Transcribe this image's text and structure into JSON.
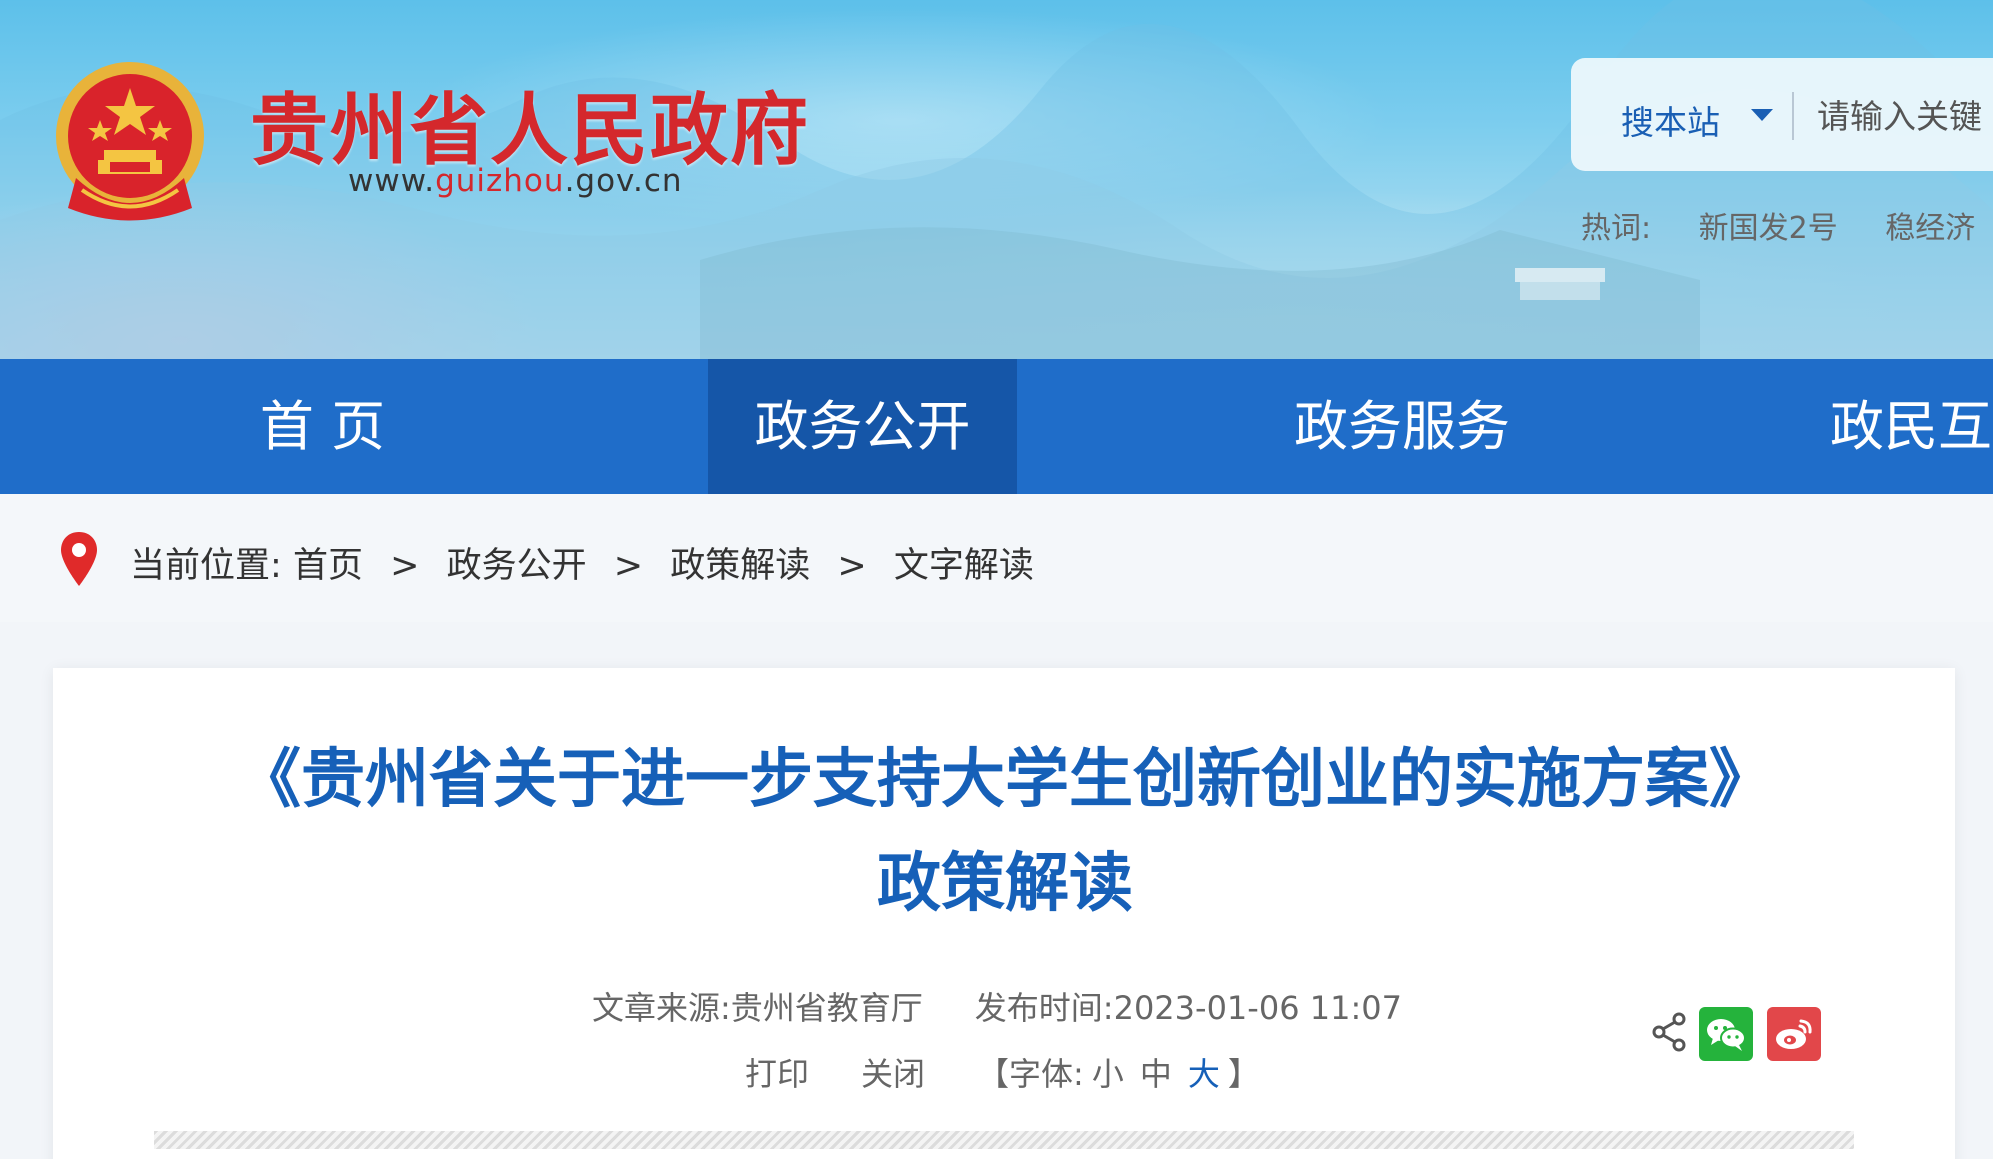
{
  "header": {
    "site_title": "贵州省人民政府",
    "url_prefix": "www.",
    "url_highlight": "guizhou",
    "url_suffix": ".gov.cn",
    "search": {
      "scope_label": "搜本站",
      "placeholder": "请输入关键"
    },
    "hotwords_label": "热词:",
    "hotwords": [
      "新国发2号",
      "稳经济"
    ]
  },
  "nav": {
    "items": [
      {
        "label": "首 页"
      },
      {
        "label": "政务公开",
        "active": true
      },
      {
        "label": "政务服务"
      },
      {
        "label": "政民互"
      }
    ]
  },
  "breadcrumb": {
    "prefix": "当前位置:",
    "items": [
      "首页",
      "政务公开",
      "政策解读",
      "文字解读"
    ],
    "separator": ">"
  },
  "article": {
    "title_line1": "《贵州省关于进一步支持大学生创新创业的实施方案》",
    "title_line2": "政策解读",
    "source_label": "文章来源:贵州省教育厅",
    "publish_label": "发布时间:2023-01-06 11:07",
    "print_label": "打印",
    "close_label": "关闭",
    "font_label_open": "【字体:",
    "font_small": "小",
    "font_medium": "中",
    "font_large": "大",
    "font_label_close": "】",
    "active_font_size": "大"
  },
  "colors": {
    "nav_bg": "#1f6dc9",
    "nav_active_bg": "#1556a8",
    "title_blue": "#1660b8",
    "brand_red": "#d4282c",
    "wechat_green": "#25b33c",
    "weibo_red": "#e2474a"
  }
}
